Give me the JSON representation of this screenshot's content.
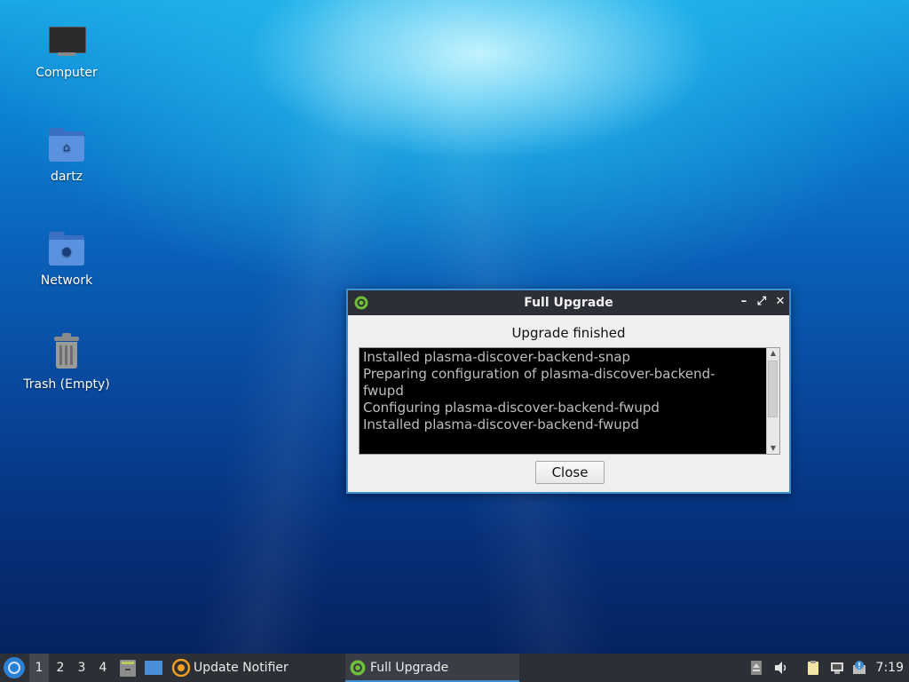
{
  "desktop": {
    "icons": [
      {
        "label": "Computer",
        "icon": "computer-icon"
      },
      {
        "label": "dartz",
        "icon": "home-folder-icon"
      },
      {
        "label": "Network",
        "icon": "network-folder-icon"
      },
      {
        "label": "Trash (Empty)",
        "icon": "trash-icon"
      }
    ]
  },
  "dialog": {
    "title": "Full Upgrade",
    "heading": "Upgrade finished",
    "log_lines": [
      "Installed plasma-discover-backend-snap",
      "Preparing configuration of plasma-discover-backend-",
      "fwupd",
      "Configuring plasma-discover-backend-fwupd",
      "Installed plasma-discover-backend-fwupd"
    ],
    "close_label": "Close",
    "title_buttons": {
      "minimize": "–",
      "maximize": "⤢",
      "close": "✕"
    }
  },
  "taskbar": {
    "workspaces": [
      "1",
      "2",
      "3",
      "4"
    ],
    "active_workspace": "1",
    "tasks": [
      {
        "label": "Update Notifier",
        "icon": "update-notifier-icon"
      },
      {
        "label": "Full Upgrade",
        "icon": "gear-icon"
      }
    ],
    "clock": "7:19"
  },
  "colors": {
    "titlebar": "#2d2f36",
    "accent": "#3e8ed4",
    "terminal_bg": "#000000",
    "terminal_fg": "#bdbdbd"
  }
}
